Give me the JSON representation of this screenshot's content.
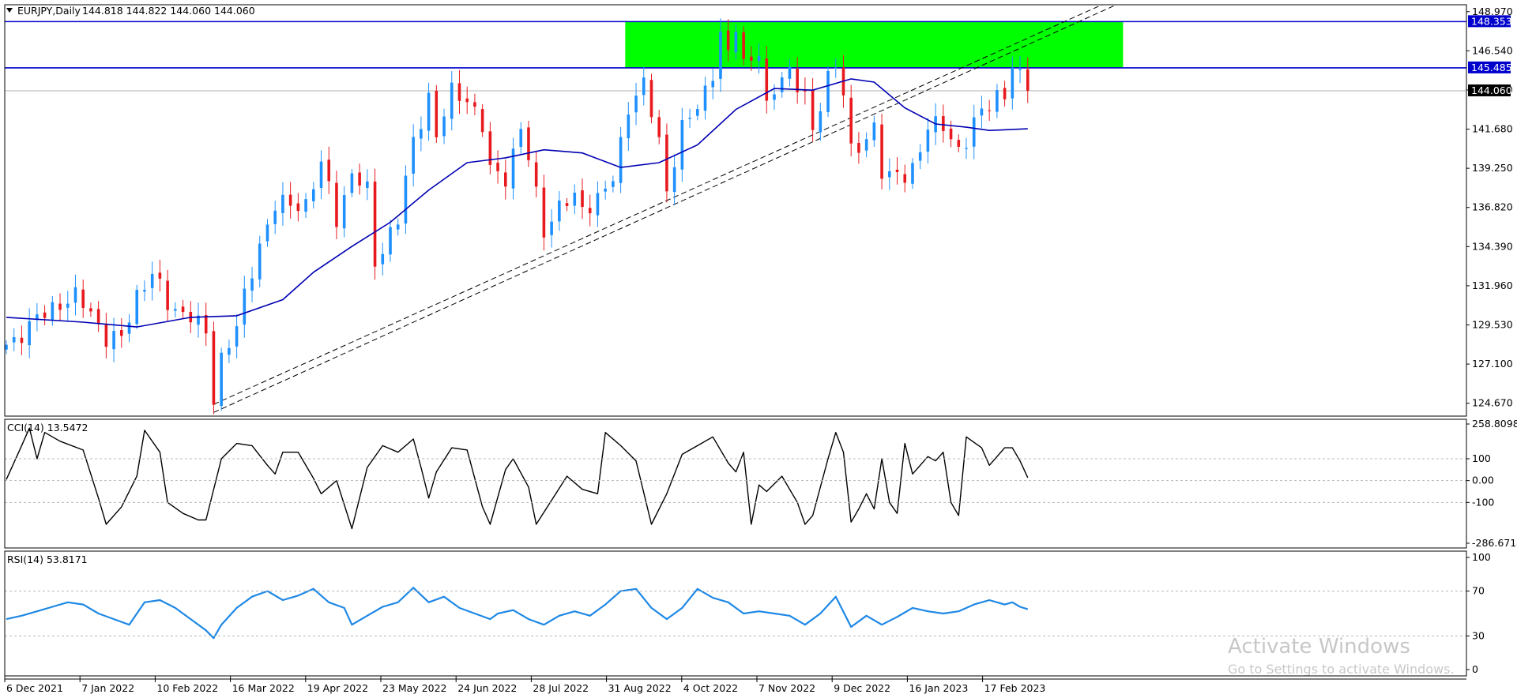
{
  "header": {
    "symbol": "EURJPY,Daily",
    "ohlc": "144.818 144.822 144.060 144.060"
  },
  "chart_data": {
    "type": "candlestick",
    "symbol": "EURJPY",
    "timeframe": "Daily",
    "last_close": 144.06,
    "y_axis_ticks": [
      "148.970",
      "146.540",
      "144.110",
      "141.680",
      "139.250",
      "136.820",
      "134.390",
      "131.960",
      "129.530",
      "127.100",
      "124.670"
    ],
    "ylim": [
      123.87,
      149.4
    ],
    "x_axis_labels": [
      "6 Dec 2021",
      "7 Jan 2022",
      "10 Feb 2022",
      "16 Mar 2022",
      "19 Apr 2022",
      "23 May 2022",
      "24 Jun 2022",
      "28 Jul 2022",
      "31 Aug 2022",
      "4 Oct 2022",
      "7 Nov 2022",
      "9 Dec 2022",
      "16 Jan 2023",
      "17 Feb 2023"
    ],
    "price_path": [
      [
        0,
        128.3
      ],
      [
        3,
        129.4
      ],
      [
        6,
        130.7
      ],
      [
        9,
        131.2
      ],
      [
        11,
        130.4
      ],
      [
        13,
        128.7
      ],
      [
        15,
        128.6
      ],
      [
        17,
        131.5
      ],
      [
        19,
        132.7
      ],
      [
        21,
        130.8
      ],
      [
        24,
        130.1
      ],
      [
        26,
        128.9
      ],
      [
        27,
        125.0
      ],
      [
        28,
        127.6
      ],
      [
        30,
        129.3
      ],
      [
        31,
        131.2
      ],
      [
        33,
        134.6
      ],
      [
        35,
        136.9
      ],
      [
        37,
        137.0
      ],
      [
        39,
        137.1
      ],
      [
        41,
        139.4
      ],
      [
        42,
        138.0
      ],
      [
        43,
        136.2
      ],
      [
        45,
        138.9
      ],
      [
        47,
        137.8
      ],
      [
        48,
        133.4
      ],
      [
        50,
        135.3
      ],
      [
        51,
        136.0
      ],
      [
        53,
        140.9
      ],
      [
        55,
        143.8
      ],
      [
        56,
        141.1
      ],
      [
        58,
        144.0
      ],
      [
        60,
        143.7
      ],
      [
        62,
        141.7
      ],
      [
        63,
        139.1
      ],
      [
        65,
        138.8
      ],
      [
        67,
        141.6
      ],
      [
        68,
        139.8
      ],
      [
        70,
        135.5
      ],
      [
        72,
        136.8
      ],
      [
        74,
        137.4
      ],
      [
        75,
        136.9
      ],
      [
        77,
        137.3
      ],
      [
        79,
        138.5
      ],
      [
        81,
        143.2
      ],
      [
        83,
        144.4
      ],
      [
        85,
        140.9
      ],
      [
        86,
        138.0
      ],
      [
        88,
        141.7
      ],
      [
        90,
        143.0
      ],
      [
        92,
        145.3
      ],
      [
        93,
        147.6
      ],
      [
        94,
        146.1
      ],
      [
        95,
        148.0
      ],
      [
        96,
        145.8
      ],
      [
        98,
        146.6
      ],
      [
        99,
        142.8
      ],
      [
        101,
        145.0
      ],
      [
        102,
        145.4
      ],
      [
        104,
        143.7
      ],
      [
        105,
        141.2
      ],
      [
        107,
        145.1
      ],
      [
        108,
        145.8
      ],
      [
        109,
        144.0
      ],
      [
        110,
        140.1
      ],
      [
        111,
        140.4
      ],
      [
        113,
        142.0
      ],
      [
        114,
        139.1
      ],
      [
        115,
        138.6
      ],
      [
        117,
        138.8
      ],
      [
        118,
        139.4
      ],
      [
        120,
        141.7
      ],
      [
        122,
        141.9
      ],
      [
        124,
        140.5
      ],
      [
        125,
        140.9
      ],
      [
        127,
        142.8
      ],
      [
        129,
        143.9
      ],
      [
        130,
        143.8
      ],
      [
        131,
        145.4
      ],
      [
        132,
        144.8
      ],
      [
        133,
        144.06
      ]
    ],
    "series": [
      {
        "name": "",
        "type": "moving-average",
        "color": "#0000b3",
        "path": [
          [
            0,
            130.0
          ],
          [
            10,
            129.7
          ],
          [
            17,
            129.4
          ],
          [
            24,
            130.0
          ],
          [
            30,
            130.1
          ],
          [
            36,
            131.1
          ],
          [
            40,
            132.8
          ],
          [
            45,
            134.4
          ],
          [
            50,
            135.9
          ],
          [
            55,
            137.9
          ],
          [
            60,
            139.6
          ],
          [
            65,
            139.9
          ],
          [
            70,
            140.4
          ],
          [
            75,
            140.2
          ],
          [
            80,
            139.3
          ],
          [
            85,
            139.6
          ],
          [
            90,
            140.7
          ],
          [
            95,
            142.9
          ],
          [
            100,
            144.2
          ],
          [
            105,
            144.1
          ],
          [
            110,
            144.8
          ],
          [
            113,
            144.6
          ],
          [
            117,
            143.0
          ],
          [
            121,
            142.0
          ],
          [
            125,
            141.8
          ],
          [
            128,
            141.6
          ],
          [
            133,
            141.7
          ]
        ]
      }
    ],
    "levels": [
      {
        "value": 148.353,
        "label": "148.353",
        "color": "#0000cc"
      },
      {
        "value": 145.485,
        "label": "145.485",
        "color": "#0000cc"
      },
      {
        "value": 144.06,
        "label": "144.060",
        "color": "#000000"
      }
    ],
    "supply_zone": {
      "x_start_index": 81,
      "x_end_index": 145,
      "y_low": 145.485,
      "y_high": 148.353,
      "color": "#00ff00"
    },
    "trendlines": [
      {
        "style": "dashed",
        "from": [
          27,
          124.6
        ],
        "to": [
          145,
          149.9
        ]
      },
      {
        "style": "dashed",
        "from": [
          27,
          124.1
        ],
        "to": [
          145,
          149.5
        ]
      }
    ],
    "indicators": [
      {
        "name": "CCI(14)",
        "label": "CCI(14) 13.5472",
        "value": 13.5472,
        "ticks": [
          "258.8098",
          "100",
          "0.00",
          "-100",
          "-286.6714"
        ],
        "ylim": [
          -286.6714,
          258.8098
        ],
        "path": [
          [
            0,
            5
          ],
          [
            2,
            160
          ],
          [
            3,
            240
          ],
          [
            4,
            100
          ],
          [
            5,
            220
          ],
          [
            7,
            180
          ],
          [
            10,
            140
          ],
          [
            12,
            -80
          ],
          [
            13,
            -200
          ],
          [
            15,
            -120
          ],
          [
            17,
            20
          ],
          [
            18,
            230
          ],
          [
            20,
            130
          ],
          [
            21,
            -100
          ],
          [
            23,
            -150
          ],
          [
            25,
            -180
          ],
          [
            26,
            -180
          ],
          [
            28,
            100
          ],
          [
            30,
            170
          ],
          [
            32,
            160
          ],
          [
            34,
            70
          ],
          [
            35,
            30
          ],
          [
            36,
            130
          ],
          [
            38,
            130
          ],
          [
            40,
            10
          ],
          [
            41,
            -60
          ],
          [
            43,
            0
          ],
          [
            45,
            -220
          ],
          [
            47,
            60
          ],
          [
            49,
            160
          ],
          [
            51,
            130
          ],
          [
            53,
            190
          ],
          [
            54,
            60
          ],
          [
            55,
            -80
          ],
          [
            56,
            40
          ],
          [
            58,
            150
          ],
          [
            60,
            140
          ],
          [
            62,
            -120
          ],
          [
            63,
            -200
          ],
          [
            65,
            50
          ],
          [
            66,
            100
          ],
          [
            68,
            -30
          ],
          [
            69,
            -200
          ],
          [
            71,
            -90
          ],
          [
            73,
            20
          ],
          [
            75,
            -40
          ],
          [
            77,
            -60
          ],
          [
            78,
            220
          ],
          [
            80,
            160
          ],
          [
            82,
            90
          ],
          [
            84,
            -200
          ],
          [
            86,
            -60
          ],
          [
            88,
            120
          ],
          [
            90,
            160
          ],
          [
            92,
            200
          ],
          [
            94,
            80
          ],
          [
            95,
            40
          ],
          [
            96,
            130
          ],
          [
            97,
            -200
          ],
          [
            98,
            -20
          ],
          [
            99,
            -50
          ],
          [
            101,
            20
          ],
          [
            103,
            -100
          ],
          [
            104,
            -200
          ],
          [
            105,
            -160
          ],
          [
            107,
            100
          ],
          [
            108,
            220
          ],
          [
            109,
            130
          ],
          [
            110,
            -190
          ],
          [
            111,
            -130
          ],
          [
            112,
            -60
          ],
          [
            113,
            -130
          ],
          [
            114,
            100
          ],
          [
            115,
            -100
          ],
          [
            116,
            -150
          ],
          [
            117,
            170
          ],
          [
            118,
            30
          ],
          [
            120,
            110
          ],
          [
            121,
            90
          ],
          [
            122,
            130
          ],
          [
            123,
            -100
          ],
          [
            124,
            -160
          ],
          [
            125,
            200
          ],
          [
            127,
            150
          ],
          [
            128,
            70
          ],
          [
            130,
            150
          ],
          [
            131,
            150
          ],
          [
            132,
            90
          ],
          [
            133,
            13.5
          ]
        ]
      },
      {
        "name": "RSI(14)",
        "label": "RSI(14) 53.8171",
        "value": 53.8171,
        "ticks": [
          "100",
          "70",
          "30",
          "0"
        ],
        "ylim": [
          0,
          100
        ],
        "path": [
          [
            0,
            45
          ],
          [
            2,
            48
          ],
          [
            4,
            52
          ],
          [
            6,
            56
          ],
          [
            8,
            60
          ],
          [
            10,
            58
          ],
          [
            12,
            50
          ],
          [
            14,
            45
          ],
          [
            16,
            40
          ],
          [
            18,
            60
          ],
          [
            20,
            62
          ],
          [
            22,
            55
          ],
          [
            24,
            45
          ],
          [
            26,
            35
          ],
          [
            27,
            28
          ],
          [
            28,
            40
          ],
          [
            30,
            55
          ],
          [
            32,
            65
          ],
          [
            34,
            70
          ],
          [
            36,
            62
          ],
          [
            38,
            66
          ],
          [
            40,
            72
          ],
          [
            42,
            60
          ],
          [
            44,
            55
          ],
          [
            45,
            40
          ],
          [
            47,
            48
          ],
          [
            49,
            56
          ],
          [
            51,
            60
          ],
          [
            53,
            73
          ],
          [
            55,
            60
          ],
          [
            57,
            65
          ],
          [
            59,
            55
          ],
          [
            61,
            50
          ],
          [
            63,
            45
          ],
          [
            64,
            50
          ],
          [
            66,
            53
          ],
          [
            68,
            45
          ],
          [
            70,
            40
          ],
          [
            72,
            48
          ],
          [
            74,
            52
          ],
          [
            76,
            48
          ],
          [
            78,
            58
          ],
          [
            80,
            70
          ],
          [
            82,
            72
          ],
          [
            84,
            55
          ],
          [
            86,
            45
          ],
          [
            88,
            55
          ],
          [
            90,
            72
          ],
          [
            92,
            64
          ],
          [
            94,
            60
          ],
          [
            96,
            50
          ],
          [
            98,
            52
          ],
          [
            100,
            50
          ],
          [
            102,
            48
          ],
          [
            104,
            40
          ],
          [
            106,
            50
          ],
          [
            108,
            65
          ],
          [
            110,
            38
          ],
          [
            112,
            48
          ],
          [
            114,
            40
          ],
          [
            116,
            47
          ],
          [
            118,
            55
          ],
          [
            120,
            52
          ],
          [
            122,
            50
          ],
          [
            124,
            52
          ],
          [
            126,
            58
          ],
          [
            128,
            62
          ],
          [
            130,
            58
          ],
          [
            131,
            60
          ],
          [
            132,
            56
          ],
          [
            133,
            53.8
          ]
        ]
      }
    ],
    "grid": false
  },
  "watermark": {
    "line1": "Activate Windows",
    "line2": "Go to Settings to activate Windows."
  },
  "colors": {
    "bull": "#1e90ff",
    "bear": "#e8191e",
    "ma": "#0000b3",
    "zone": "#00ff00",
    "cci": "#000000",
    "rsi": "#1e88e5"
  }
}
